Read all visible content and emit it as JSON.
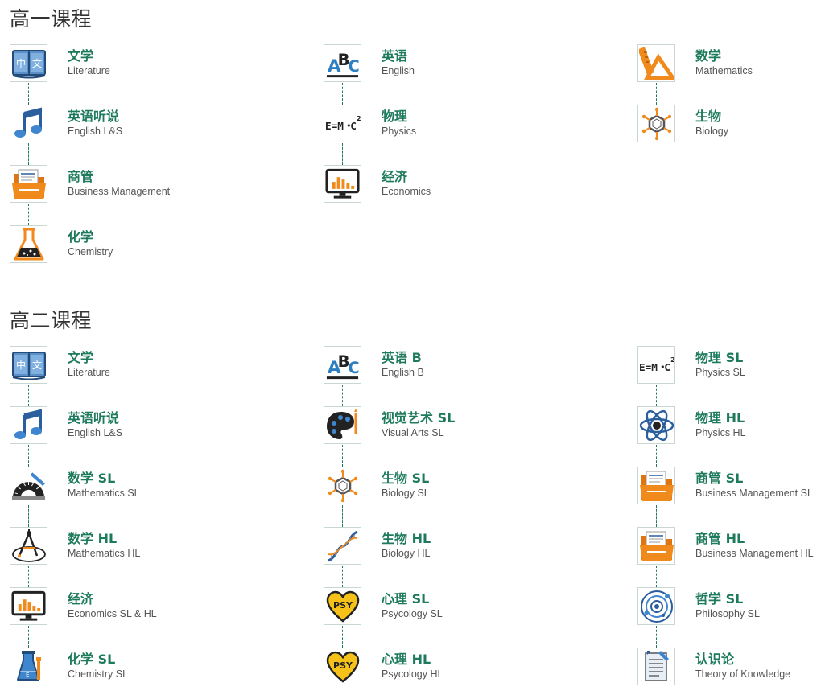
{
  "sections": [
    {
      "title": "高一课程",
      "columns": [
        [
          {
            "cn": "文学",
            "en": "Literature",
            "icon": "book-icon"
          },
          {
            "cn": "英语听说",
            "en": "English L&S",
            "icon": "music-note-icon"
          },
          {
            "cn": "商管",
            "en": "Business Management",
            "icon": "folder-icon"
          },
          {
            "cn": "化学",
            "en": "Chemistry",
            "icon": "flask-icon"
          }
        ],
        [
          {
            "cn": "英语",
            "en": "English",
            "icon": "abc-icon"
          },
          {
            "cn": "物理",
            "en": "Physics",
            "icon": "emc2-icon"
          },
          {
            "cn": "经济",
            "en": "Economics",
            "icon": "monitor-chart-icon"
          }
        ],
        [
          {
            "cn": "数学",
            "en": "Mathematics",
            "icon": "ruler-icon"
          },
          {
            "cn": "生物",
            "en": "Biology",
            "icon": "molecule-icon"
          }
        ]
      ]
    },
    {
      "title": "高二课程",
      "columns": [
        [
          {
            "cn": "文学",
            "en": "Literature",
            "icon": "book-icon"
          },
          {
            "cn": "英语听说",
            "en": "English L&S",
            "icon": "music-note-icon"
          },
          {
            "cn": "数学 SL",
            "en": "Mathematics SL",
            "icon": "protractor-icon"
          },
          {
            "cn": "数学 HL",
            "en": "Mathematics HL",
            "icon": "compass-icon"
          },
          {
            "cn": "经济",
            "en": "Economics SL & HL",
            "icon": "monitor-chart-icon"
          },
          {
            "cn": "化学 SL",
            "en": "Chemistry SL",
            "icon": "test-tube-icon"
          }
        ],
        [
          {
            "cn": "英语 B",
            "en": "English B",
            "icon": "abc-icon"
          },
          {
            "cn": "视觉艺术 SL",
            "en": "Visual Arts SL",
            "icon": "palette-icon"
          },
          {
            "cn": "生物 SL",
            "en": "Biology SL",
            "icon": "molecule-icon"
          },
          {
            "cn": "生物 HL",
            "en": "Biology HL",
            "icon": "dna-icon"
          },
          {
            "cn": "心理 SL",
            "en": "Psycology SL",
            "icon": "psy-heart-icon"
          },
          {
            "cn": "心理 HL",
            "en": "Psycology HL",
            "icon": "psy-heart-icon"
          }
        ],
        [
          {
            "cn": "物理 SL",
            "en": "Physics SL",
            "icon": "emc2-icon"
          },
          {
            "cn": "物理 HL",
            "en": "Physics HL",
            "icon": "atom-icon"
          },
          {
            "cn": "商管 SL",
            "en": "Business Management SL",
            "icon": "folder-icon"
          },
          {
            "cn": "商管 HL",
            "en": "Business Management HL",
            "icon": "folder-icon"
          },
          {
            "cn": "哲学 SL",
            "en": "Philosophy SL",
            "icon": "orbit-icon"
          },
          {
            "cn": "认识论",
            "en": "Theory of Knowledge",
            "icon": "document-pen-icon"
          }
        ]
      ]
    }
  ],
  "colors": {
    "accent": "#1d7a5c",
    "orange": "#f08a1c",
    "blue": "#2d7fc1",
    "dark": "#222222",
    "yellow": "#f6c21a"
  }
}
